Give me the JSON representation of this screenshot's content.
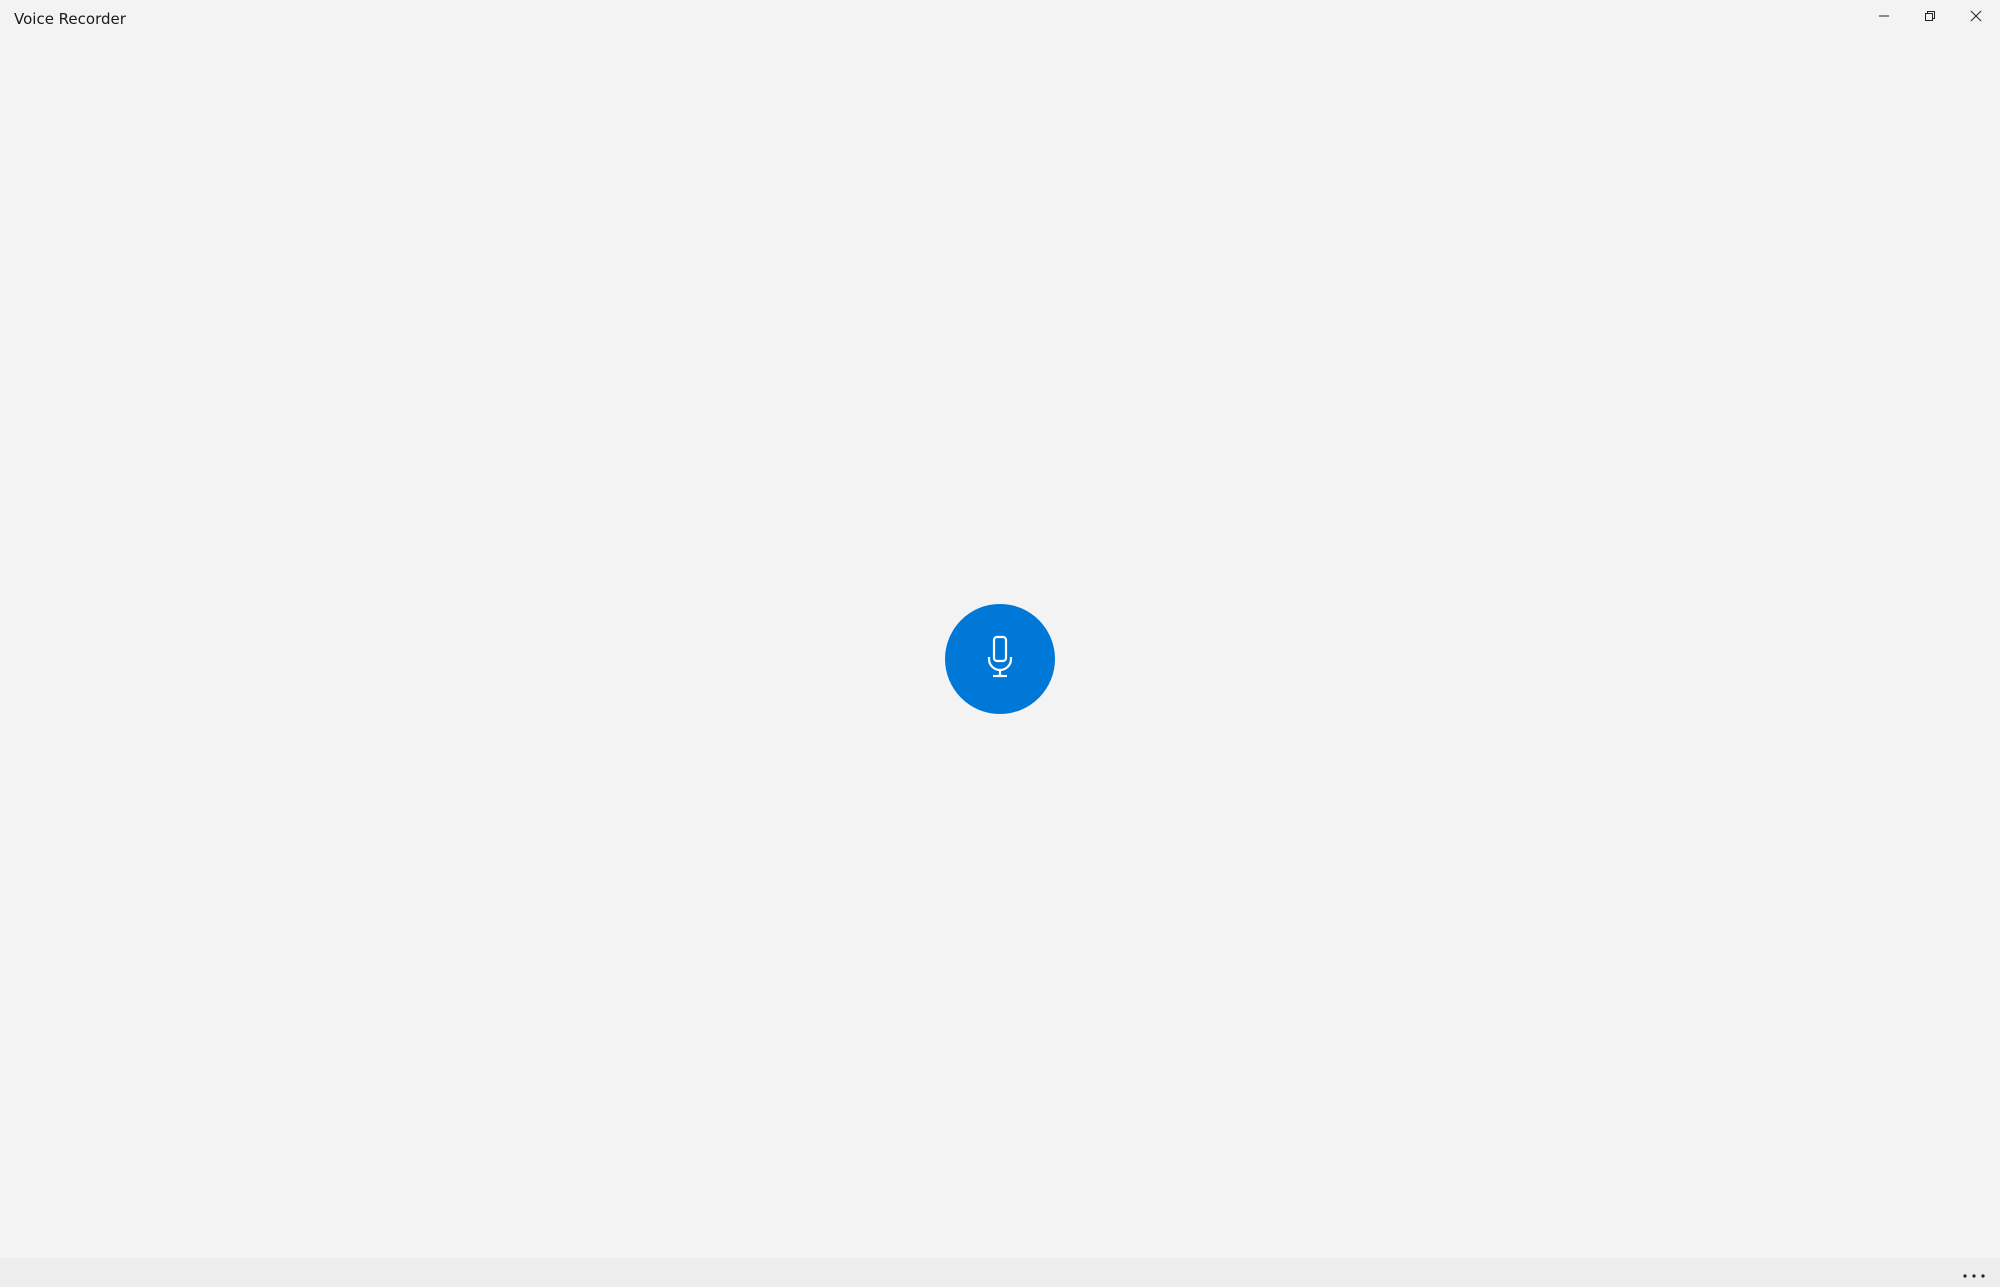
{
  "window": {
    "title": "Voice Recorder",
    "controls": {
      "minimize_icon": "minimize-icon",
      "restore_icon": "restore-icon",
      "close_icon": "close-icon"
    }
  },
  "main": {
    "record_button_icon": "microphone-icon",
    "accent_color": "#0078d7"
  },
  "command_bar": {
    "more_icon": "more-options-icon"
  },
  "colors": {
    "background": "#f3f3f3",
    "command_bar": "#ededed",
    "text": "#1a1a1a"
  }
}
